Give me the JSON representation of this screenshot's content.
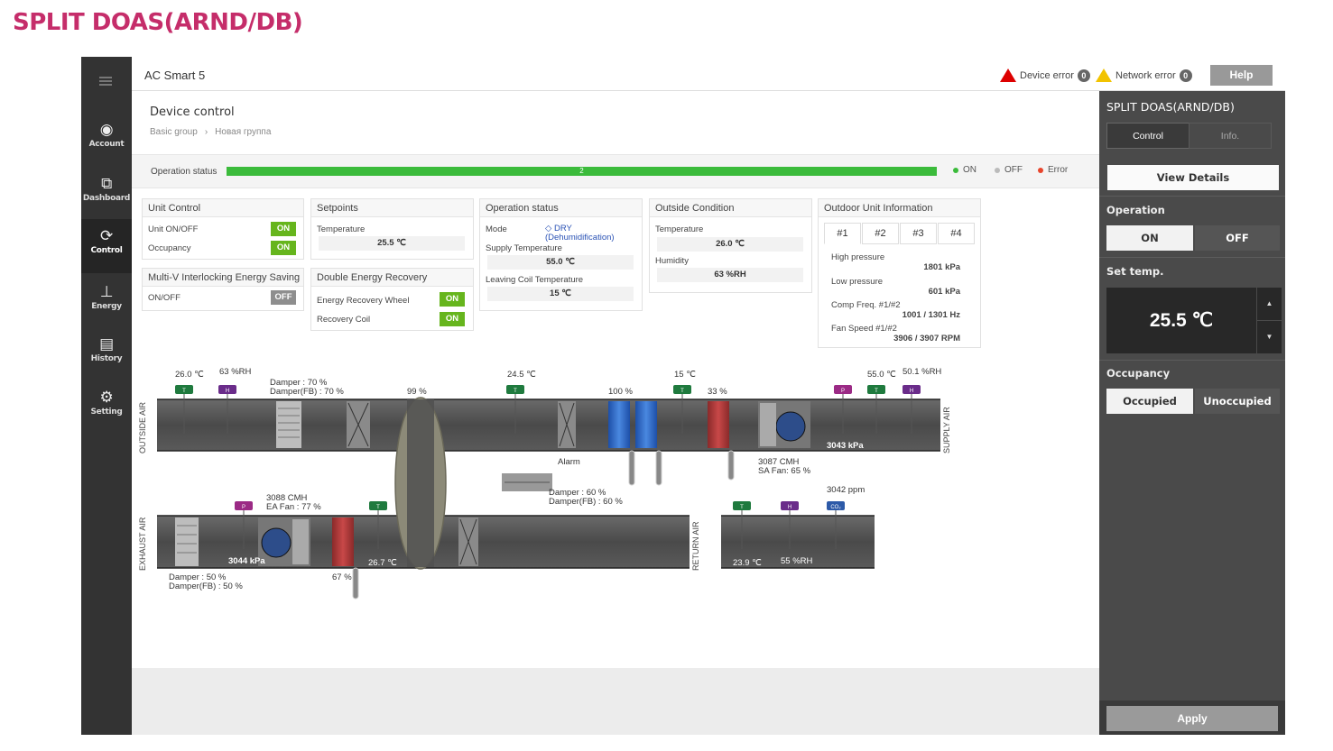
{
  "page_title": "SPLIT DOAS(ARND/DB)",
  "nav": {
    "items": [
      {
        "label": "Account",
        "icon": "account-icon"
      },
      {
        "label": "Dashboard",
        "icon": "dashboard-icon"
      },
      {
        "label": "Control",
        "icon": "control-icon"
      },
      {
        "label": "Energy",
        "icon": "energy-icon"
      },
      {
        "label": "History",
        "icon": "history-icon"
      },
      {
        "label": "Setting",
        "icon": "gear-icon"
      }
    ]
  },
  "topbar": {
    "app_name": "AC Smart 5",
    "device_error_label": "Device error",
    "device_error_count": "0",
    "network_error_label": "Network error",
    "network_error_count": "0",
    "help_label": "Help"
  },
  "header": {
    "title": "Device control",
    "breadcrumb": [
      "Basic group",
      "Новая группа"
    ]
  },
  "operation_status": {
    "label": "Operation status",
    "count": "2",
    "legend": [
      {
        "label": "ON",
        "color": "#3bbb3b"
      },
      {
        "label": "OFF",
        "color": "#bbbbbb"
      },
      {
        "label": "Error",
        "color": "#e8452c"
      }
    ]
  },
  "unit_control": {
    "title": "Unit Control",
    "rows": [
      {
        "label": "Unit ON/OFF",
        "value": "ON"
      },
      {
        "label": "Occupancy",
        "value": "ON"
      }
    ]
  },
  "multi_v": {
    "title": "Multi-V Interlocking Energy Saving",
    "label": "ON/OFF",
    "value": "OFF"
  },
  "setpoints": {
    "title": "Setpoints",
    "temp_label": "Temperature",
    "temp_value": "25.5 ℃"
  },
  "double_energy": {
    "title": "Double Energy Recovery",
    "rows": [
      {
        "label": "Energy Recovery Wheel",
        "value": "ON"
      },
      {
        "label": "Recovery Coil",
        "value": "ON"
      }
    ]
  },
  "op_status_panel": {
    "title": "Operation status",
    "mode_label": "Mode",
    "mode_value": "DRY",
    "mode_sub": "(Dehumidification)",
    "supply_label": "Supply Temperature",
    "supply_value": "55.0 ℃",
    "leaving_label": "Leaving Coil Temperature",
    "leaving_value": "15 ℃"
  },
  "outside": {
    "title": "Outside Condition",
    "temp_label": "Temperature",
    "temp_value": "26.0 ℃",
    "hum_label": "Humidity",
    "hum_value": "63 %RH"
  },
  "outdoor_unit": {
    "title": "Outdoor Unit Information",
    "tabs": [
      "#1",
      "#2",
      "#3",
      "#4"
    ],
    "rows": [
      {
        "label": "High pressure",
        "value": "1801 kPa"
      },
      {
        "label": "Low pressure",
        "value": "601 kPa"
      },
      {
        "label": "Comp Freq. #1/#2",
        "value": "1001 / 1301 Hz"
      },
      {
        "label": "Fan Speed #1/#2",
        "value": "3906 / 3907 RPM"
      }
    ]
  },
  "diagram": {
    "outside_air": "OUTSIDE AIR",
    "exhaust_air": "EXHAUST AIR",
    "supply_air": "SUPPLY AIR",
    "return_air": "RETURN AIR",
    "oa_temp": "26.0 ℃",
    "oa_hum": "63 %RH",
    "oa_damper": "Damper : 70 %",
    "oa_damper_fb": "Damper(FB) : 70 %",
    "wheel_pct": "99 %",
    "mid_temp": "24.5 ℃",
    "coil_pct": "100 %",
    "coil_temp": "15 ℃",
    "reheat_pct": "33 %",
    "sa_temp": "55.0 ℃",
    "sa_hum": "50.1 %RH",
    "sa_pressure": "3043 kPa",
    "alarm": "Alarm",
    "sa_flow": "3087 CMH",
    "sa_fan": "SA Fan: 65 %",
    "ea_flow": "3088 CMH",
    "ea_fan": "EA Fan : 77 %",
    "ea_pressure": "3044 kPa",
    "ea_temp": "26.7 ℃",
    "ea_coil_pct": "67 %",
    "ea_damper": "Damper : 50 %",
    "ea_damper_fb": "Damper(FB) : 50 %",
    "ra_damper": "Damper : 60 %",
    "ra_damper_fb": "Damper(FB) : 60 %",
    "co2": "3042 ppm",
    "ra_temp": "23.9 ℃",
    "ra_hum": "55 %RH",
    "sensor_t": "T",
    "sensor_h": "H",
    "sensor_p": "P",
    "sensor_co": "CO₂"
  },
  "sidebar": {
    "title": "SPLIT DOAS(ARND/DB)",
    "tabs": [
      "Control",
      "Info."
    ],
    "view_details": "View Details",
    "operation_label": "Operation",
    "op_on": "ON",
    "op_off": "OFF",
    "set_temp_label": "Set temp.",
    "set_temp": "25.5 ℃",
    "occupancy_label": "Occupancy",
    "occupied": "Occupied",
    "unoccupied": "Unoccupied",
    "apply": "Apply"
  }
}
